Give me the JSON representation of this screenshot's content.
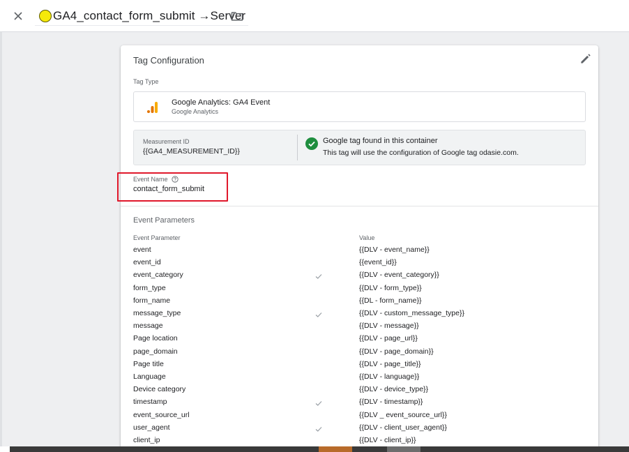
{
  "header": {
    "title": "GA4_contact_form_submit →Server",
    "close_icon": "close-icon",
    "folder_icon": "folder-icon",
    "status_dot_color": "#f6e90a"
  },
  "card": {
    "title": "Tag Configuration",
    "tag_type_label": "Tag Type",
    "tag_type_name": "Google Analytics: GA4 Event",
    "tag_type_sub": "Google Analytics",
    "measurement_label": "Measurement ID",
    "measurement_value": "{{GA4_MEASUREMENT_ID}}",
    "google_tag_title": "Google tag found in this container",
    "google_tag_sub": "This tag will use the configuration of Google tag odasie.com.",
    "event_name_label": "Event Name",
    "event_name_value": "contact_form_submit",
    "highlight_color": "#e0182b",
    "params_title": "Event Parameters",
    "col_param": "Event Parameter",
    "col_value": "Value"
  },
  "params": [
    {
      "name": "event",
      "value": "{{DLV - event_name}}",
      "checked": false
    },
    {
      "name": "event_id",
      "value": "{{event_id}}",
      "checked": false
    },
    {
      "name": "event_category",
      "value": "{{DLV - event_category}}",
      "checked": true
    },
    {
      "name": "form_type",
      "value": "{{DLV - form_type}}",
      "checked": false
    },
    {
      "name": "form_name",
      "value": "{{DL - form_name}}",
      "checked": false
    },
    {
      "name": "message_type",
      "value": "{{DLV - custom_message_type}}",
      "checked": true
    },
    {
      "name": "message",
      "value": "{{DLV - message}}",
      "checked": false
    },
    {
      "name": "Page location",
      "value": "{{DLV - page_url}}",
      "checked": false
    },
    {
      "name": "page_domain",
      "value": "{{DLV - page_domain}}",
      "checked": false
    },
    {
      "name": "Page title",
      "value": "{{DLV - page_title}}",
      "checked": false
    },
    {
      "name": "Language",
      "value": "{{DLV - language}}",
      "checked": false
    },
    {
      "name": "Device category",
      "value": "{{DLV - device_type}}",
      "checked": false
    },
    {
      "name": "timestamp",
      "value": "{{DLV - timestamp}}",
      "checked": true
    },
    {
      "name": "event_source_url",
      "value": "{{DLV _ event_source_url}}",
      "checked": false
    },
    {
      "name": "user_agent",
      "value": "{{DLV - client_user_agent}}",
      "checked": true
    },
    {
      "name": "client_ip",
      "value": "{{DLV - client_ip}}",
      "checked": false
    }
  ]
}
